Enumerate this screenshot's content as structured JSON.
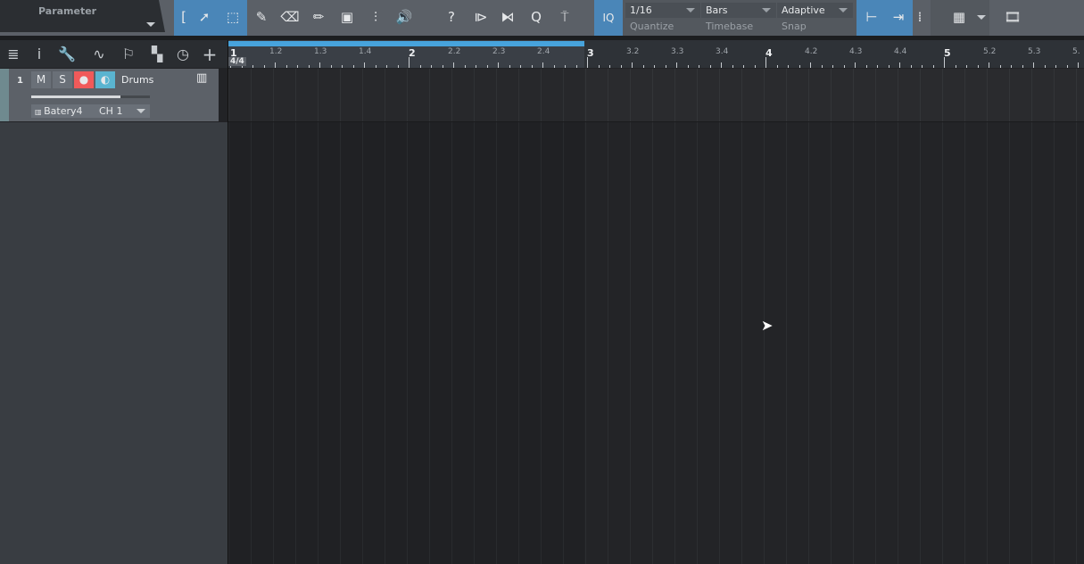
{
  "toolbar": {
    "parameter_label": "Parameter",
    "iq_label": "IQ",
    "quantize": {
      "value": "1/16",
      "label": "Quantize"
    },
    "timebase": {
      "value": "Bars",
      "label": "Timebase"
    },
    "snap": {
      "value": "Adaptive",
      "label": "Snap"
    },
    "active_color": "#4a86b8"
  },
  "ruler": {
    "time_signature": "4/4",
    "loop_color": "#47a3dc",
    "labels": [
      "1",
      "1.2",
      "1.3",
      "1.4",
      "2",
      "2.2",
      "2.3",
      "2.4",
      "3",
      "3.2",
      "3.3",
      "3.4",
      "4",
      "4.2",
      "4.3",
      "4.4",
      "5",
      "5.2",
      "5.3",
      "5."
    ]
  },
  "track": {
    "number": "1",
    "mute": "M",
    "solo": "S",
    "name": "Drums",
    "instrument": "Batery4",
    "channel": "CH 1",
    "volume_fraction": 0.75,
    "record_color": "#f05a5a",
    "monitor_color": "#5ab4d0"
  }
}
